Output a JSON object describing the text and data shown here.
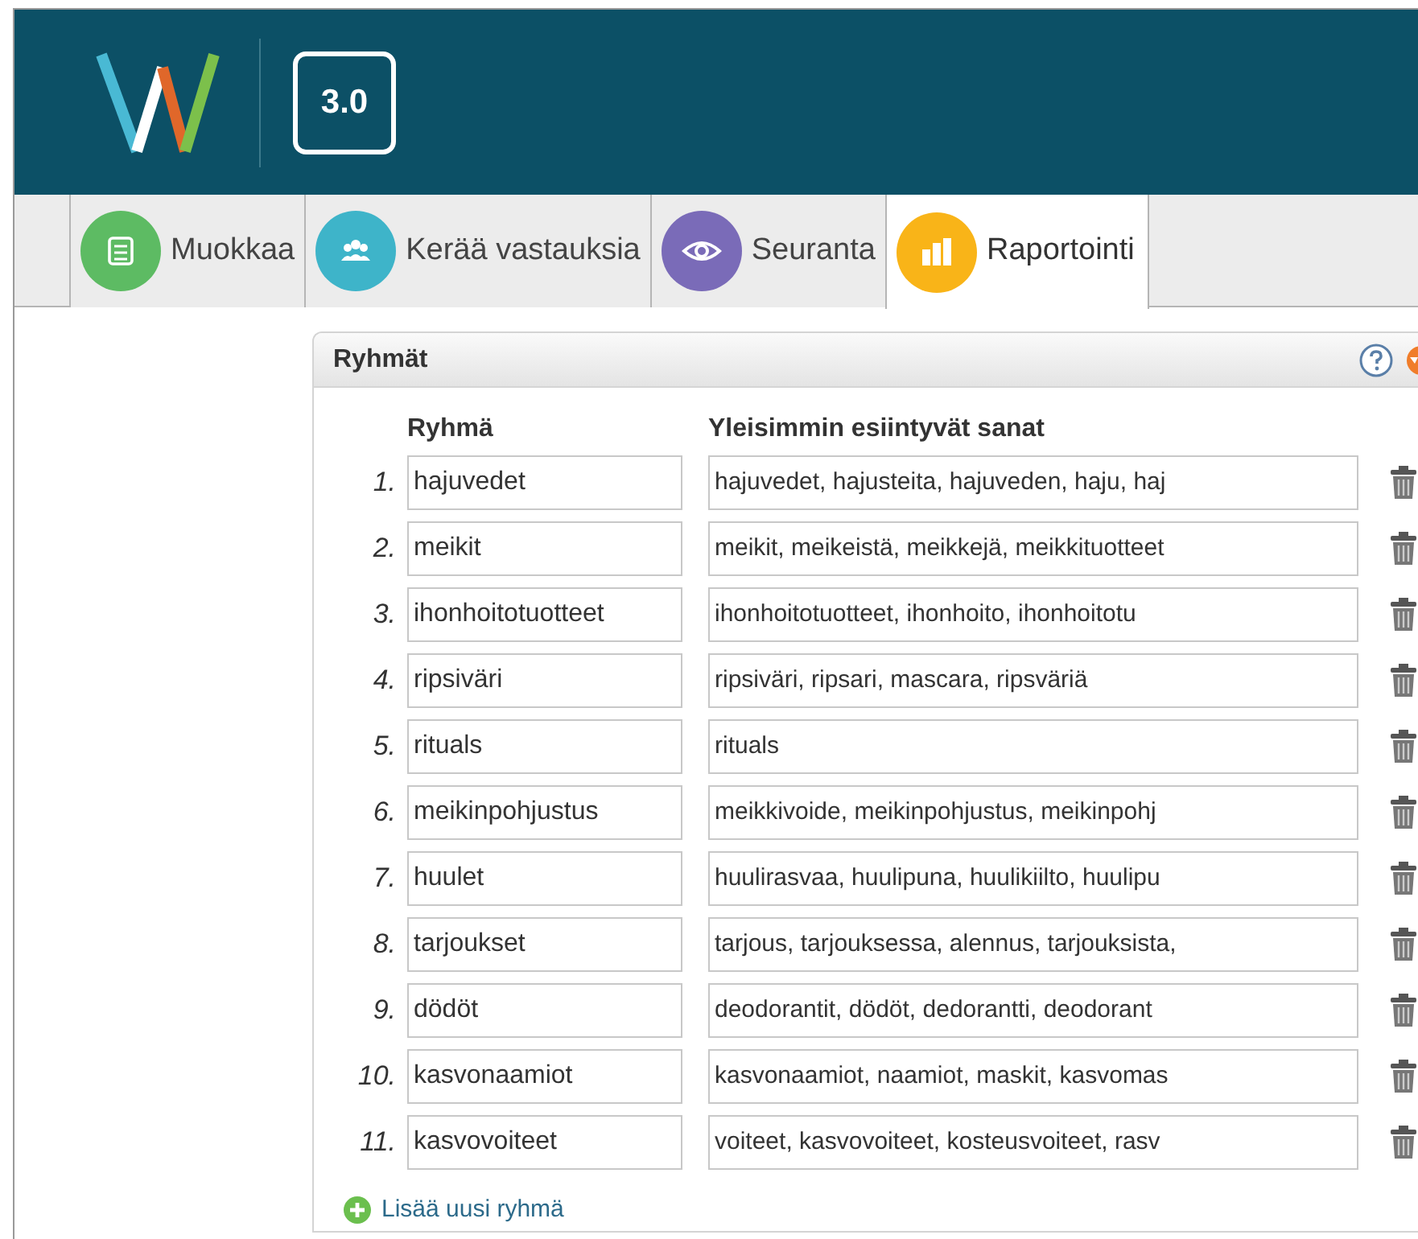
{
  "header": {
    "version_badge": "3.0"
  },
  "tabs": [
    {
      "label": "Muokkaa",
      "selected": false,
      "color": "#5dbb63"
    },
    {
      "label": "Kerää vastauksia",
      "selected": false,
      "color": "#3eb4c9"
    },
    {
      "label": "Seuranta",
      "selected": false,
      "color": "#7a6bb8"
    },
    {
      "label": "Raportointi",
      "selected": true,
      "color": "#f9b418"
    }
  ],
  "panel": {
    "title": "Ryhmät",
    "columns": [
      "Ryhmä",
      "Yleisimmin esiintyvät sanat"
    ],
    "rows": [
      {
        "number": "1.",
        "group": "hajuvedet",
        "words": "hajuvedet, hajusteita,  hajuveden, haju, haj"
      },
      {
        "number": "2.",
        "group": "meikit",
        "words": "meikit, meikeistä, meikkejä, meikkituotteet"
      },
      {
        "number": "3.",
        "group": "ihonhoitotuotteet",
        "words": "ihonhoitotuotteet, ihonhoito, ihonhoitotu"
      },
      {
        "number": "4.",
        "group": "ripsiväri",
        "words": "ripsiväri, ripsari, mascara, ripsväriä"
      },
      {
        "number": "5.",
        "group": "rituals",
        "words": "rituals"
      },
      {
        "number": "6.",
        "group": "meikinpohjustus",
        "words": "meikkivoide, meikinpohjustus, meikinpohj"
      },
      {
        "number": "7.",
        "group": "huulet",
        "words": "huulirasvaa, huulipuna, huulikiilto, huulipu"
      },
      {
        "number": "8.",
        "group": "tarjoukset",
        "words": "tarjous, tarjouksessa, alennus, tarjouksista,"
      },
      {
        "number": "9.",
        "group": "dödöt",
        "words": "deodorantit, dödöt, dedorantti, deodorant"
      },
      {
        "number": "10.",
        "group": "kasvonaamiot",
        "words": "kasvonaamiot, naamiot, maskit, kasvomas"
      },
      {
        "number": "11.",
        "group": "kasvovoiteet",
        "words": "voiteet, kasvovoiteet, kosteusvoiteet, rasv"
      }
    ],
    "add_link": "Lisää uusi ryhmä"
  }
}
